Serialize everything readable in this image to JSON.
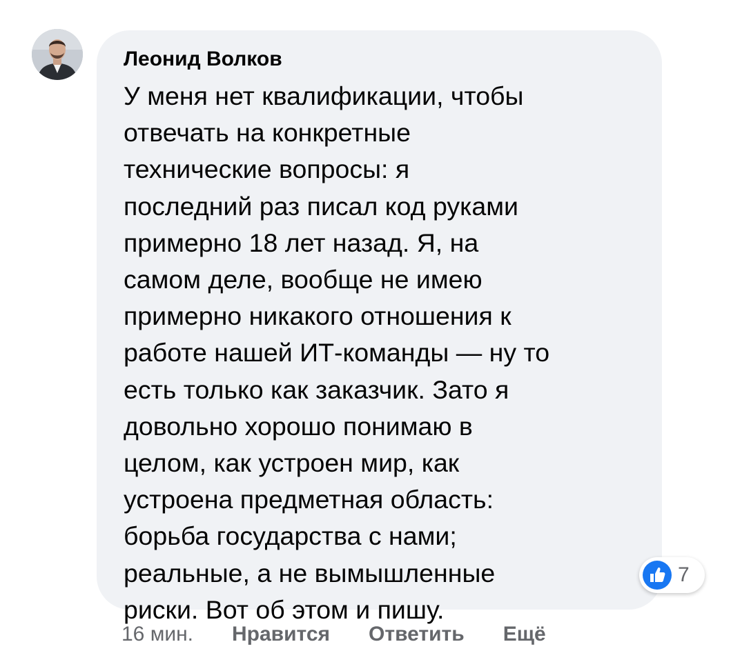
{
  "comment": {
    "author": "Леонид Волков",
    "lines": [
      "У меня нет квалификации, чтобы",
      "отвечать на конкретные",
      "технические вопросы: я",
      "последний раз писал код руками",
      "примерно 18 лет назад. Я, на",
      "самом деле, вообще не имею",
      "примерно никакого отношения к",
      "работе нашей ИТ-команды — ну то",
      "есть только как заказчик. Зато я",
      "довольно хорошо понимаю в",
      "целом, как устроен мир, как",
      "устроена предметная область:",
      "борьба государства с нами;",
      "реальные, а не вымышленные",
      "риски. Вот об этом и пишу."
    ],
    "reactions": {
      "icon": "like-icon",
      "count": "7",
      "color": "#1877f2"
    },
    "actions": {
      "timestamp": "16 мин.",
      "like_label": "Нравится",
      "reply_label": "Ответить",
      "more_label": "Ещё"
    }
  }
}
